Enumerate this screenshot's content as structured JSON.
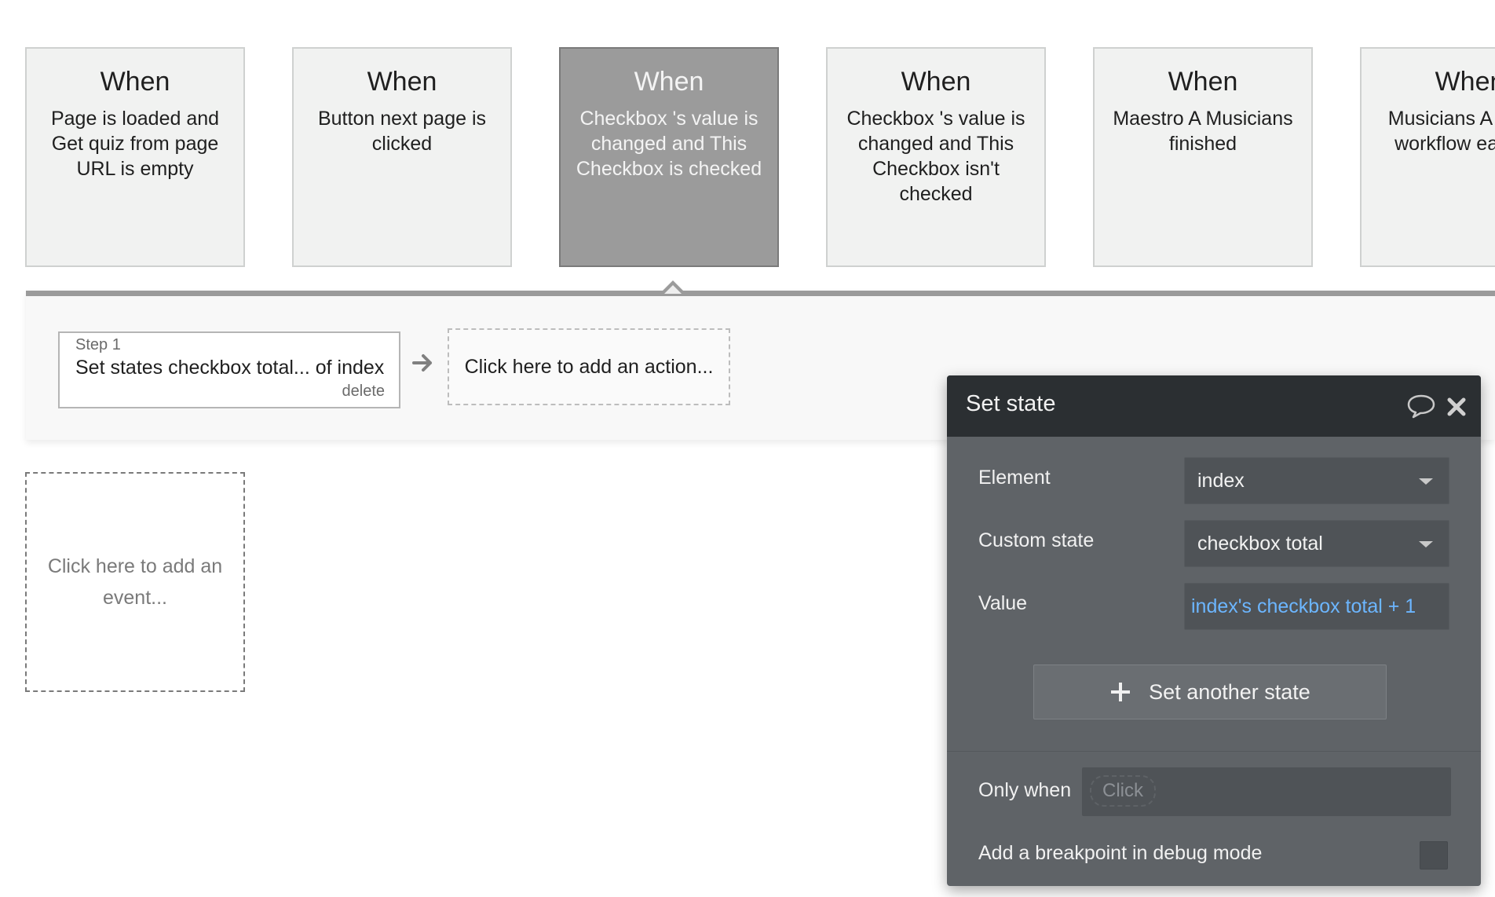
{
  "events": [
    {
      "when": "When",
      "condition": "Page is loaded and Get quiz from page URL is empty"
    },
    {
      "when": "When",
      "condition": "Button next page is clicked"
    },
    {
      "when": "When",
      "condition": "Checkbox 's value is changed and This Checkbox is checked"
    },
    {
      "when": "When",
      "condition": "Checkbox 's value is changed and This Checkbox isn't checked"
    },
    {
      "when": "When",
      "condition": "Maestro A Musicians finished"
    },
    {
      "when": "When",
      "condition": "Musicians A W this workflow each ce"
    }
  ],
  "selected_event_index": 2,
  "workflow": {
    "step_label": "Step 1",
    "step_title": "Set states checkbox total... of index",
    "step_delete": "delete",
    "add_action": "Click here to add an action..."
  },
  "add_event": "Click here to add an event...",
  "panel": {
    "title": "Set state",
    "element_label": "Element",
    "element_value": "index",
    "custom_state_label": "Custom state",
    "custom_state_value": "checkbox total",
    "value_label": "Value",
    "value_expression": "index's checkbox total + 1",
    "set_another_label": "Set another state",
    "only_when_label": "Only when",
    "only_when_placeholder": "Click",
    "breakpoint_label": "Add a breakpoint in debug mode"
  },
  "icons": {
    "comment": "comment-icon",
    "close": "close-icon",
    "arrow": "arrow-right-icon",
    "plus": "plus-icon",
    "caret": "chevron-down-icon"
  },
  "colors": {
    "selected_card": "#9b9b9b",
    "panel_bg": "#5f6367",
    "panel_header": "#2b2f32",
    "expression_link": "#6cb6ff"
  }
}
